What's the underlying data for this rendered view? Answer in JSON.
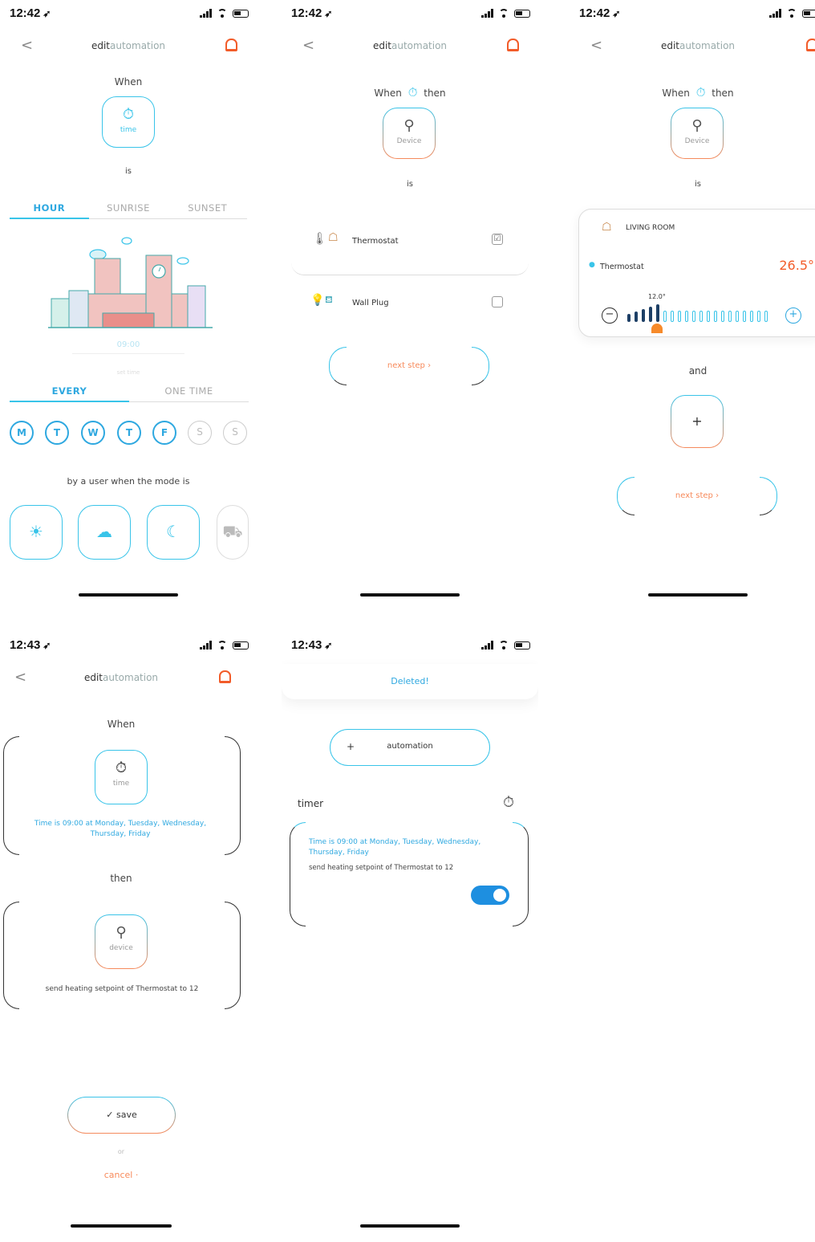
{
  "status": {
    "time_a": "12:42",
    "time_b": "12:43"
  },
  "nav": {
    "title_bold": "edit",
    "title_rest": "automation",
    "back": "<"
  },
  "screen1": {
    "when": "When",
    "tile_label": "time",
    "is": "is",
    "tabs": [
      "HOUR",
      "SUNRISE",
      "SUNSET"
    ],
    "time_value": "09:00",
    "set_time": "set time",
    "freq_tabs": [
      "EVERY",
      "ONE TIME"
    ],
    "days": [
      "M",
      "T",
      "W",
      "T",
      "F",
      "S",
      "S"
    ],
    "by_user": "by a user when the mode is"
  },
  "screen2": {
    "when": "When",
    "then": "then",
    "tile_label": "Device",
    "is": "is",
    "devices": [
      {
        "name": "Thermostat",
        "checked": "☑"
      },
      {
        "name": "Wall Plug",
        "checked": ""
      }
    ],
    "next_step": "next step ›"
  },
  "screen3": {
    "when": "When",
    "then": "then",
    "tile_label": "Device",
    "is": "is",
    "room": "LIVING ROOM",
    "device": "Thermostat",
    "current_temp": "26.5°",
    "setpoint": "12.0°",
    "setpoint_fraction": 0.22,
    "minus": "−",
    "plus": "+",
    "and": "and",
    "add": "+",
    "next_step": "next step ›"
  },
  "screen4": {
    "when": "When",
    "time_tile": "time",
    "time_desc": "Time is 09:00 at Monday, Tuesday, Wednesday, Thursday, Friday",
    "then": "then",
    "device_tile": "device",
    "action_desc": "send heating setpoint of  Thermostat  to 12",
    "save": "✓ save",
    "or": "or",
    "cancel": "cancel ·"
  },
  "screen5": {
    "toast": "Deleted!",
    "add_plus": "+",
    "add_label": "automation",
    "timer": "timer",
    "time_desc": "Time is 09:00 at Monday, Tuesday, Wednesday, Thursday, Friday",
    "action_desc": "send heating setpoint of  Thermostat  to 12",
    "toggle_on": true
  },
  "colors": {
    "accent_blue": "#39c4e9",
    "accent_orange": "#f25c2a",
    "text_blue": "#2ea8e0"
  }
}
